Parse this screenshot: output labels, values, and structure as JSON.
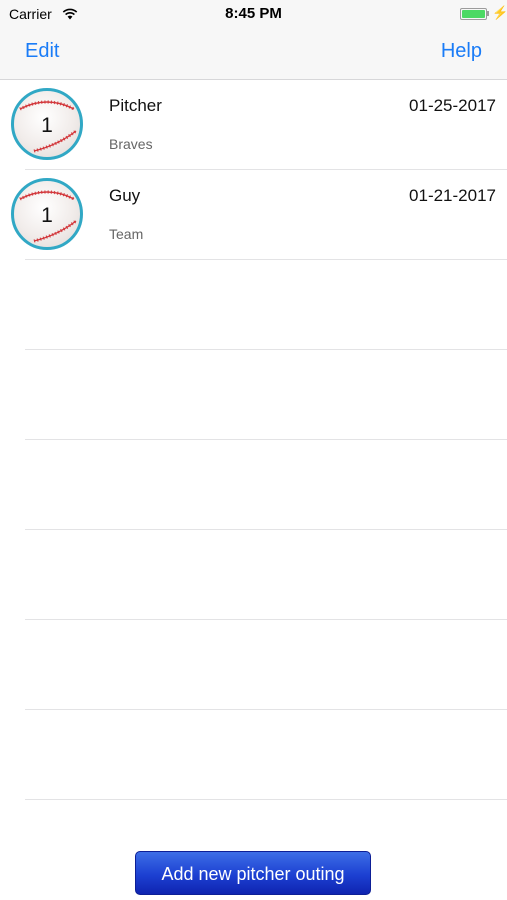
{
  "status_bar": {
    "carrier": "Carrier",
    "time": "8:45 PM",
    "battery_level": 1.0
  },
  "nav": {
    "edit_label": "Edit",
    "help_label": "Help"
  },
  "outings": [
    {
      "number": "1",
      "name": "Pitcher",
      "team": "Braves",
      "date": "01-25-2017"
    },
    {
      "number": "1",
      "name": "Guy",
      "team": "Team",
      "date": "01-21-2017"
    }
  ],
  "add_button_label": "Add new pitcher outing",
  "colors": {
    "accent": "#1a7cf7",
    "ball_ring": "#31a8c5",
    "button_blue": "#1c40d2",
    "battery_green": "#4cd964"
  }
}
